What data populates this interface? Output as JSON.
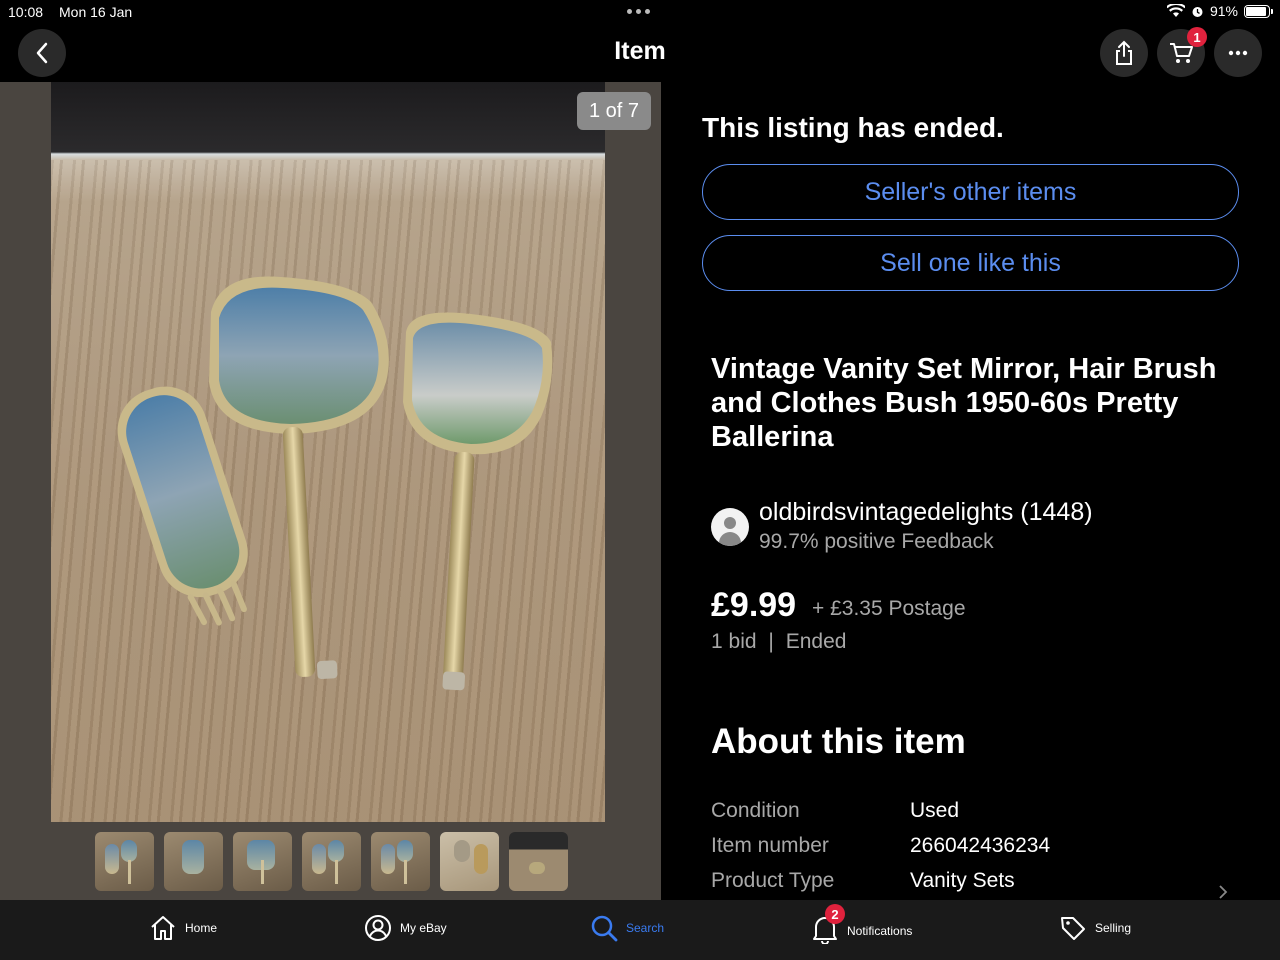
{
  "status": {
    "time": "10:08",
    "date": "Mon 16 Jan",
    "battery": "91%",
    "battery_level": 0.91
  },
  "nav": {
    "title": "Item",
    "cart_count": "1",
    "icons": [
      "back-icon",
      "share-icon",
      "cart-icon",
      "more-icon"
    ]
  },
  "gallery": {
    "counter": "1 of 7",
    "thumbnail_count": 7
  },
  "listing": {
    "status": "This listing has ended.",
    "sellers_other_items": "Seller's other items",
    "sell_one_like_this": "Sell one like this",
    "title": "Vintage Vanity Set Mirror, Hair Brush and Clothes Bush 1950-60s Pretty Ballerina",
    "seller": {
      "name": "oldbirdsvintagedelights (1448)",
      "feedback": "99.7% positive Feedback"
    },
    "price": "£9.99",
    "postage": "+ £3.35 Postage",
    "bids": "1 bid",
    "separator": "|",
    "ended": "Ended"
  },
  "about": {
    "heading": "About this item",
    "specs": [
      {
        "label": "Condition",
        "value": "Used"
      },
      {
        "label": "Item number",
        "value": "266042436234"
      },
      {
        "label": "Product Type",
        "value": "Vanity Sets"
      }
    ]
  },
  "tabs": [
    {
      "label": "Home",
      "icon": "home-icon"
    },
    {
      "label": "My eBay",
      "icon": "user-icon"
    },
    {
      "label": "Search",
      "icon": "search-icon",
      "active": true
    },
    {
      "label": "Notifications",
      "icon": "bell-icon",
      "badge": "2"
    },
    {
      "label": "Selling",
      "icon": "tag-icon"
    }
  ],
  "colors": {
    "accent": "#5b8def",
    "active_tab": "#3a7bf0",
    "badge": "#e0223d",
    "background": "#000000"
  }
}
